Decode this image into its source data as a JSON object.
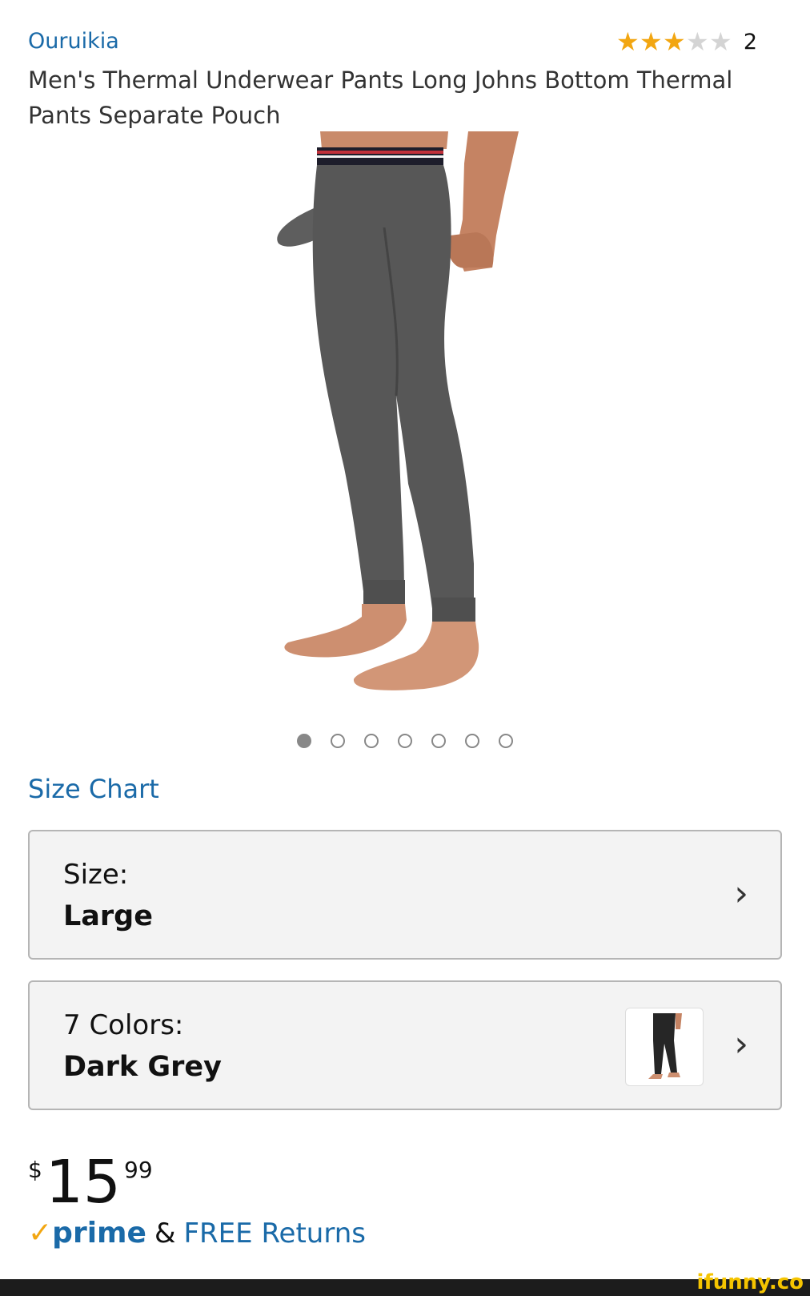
{
  "brand": "Ouruikia",
  "rating": {
    "stars_filled": 3,
    "stars_total": 5,
    "count": "2"
  },
  "title": "Men's Thermal Underwear Pants Long Johns Bottom Thermal Pants Separate Pouch",
  "carousel": {
    "total": 7,
    "active_index": 0
  },
  "size_chart_link": "Size Chart",
  "size_selector": {
    "label": "Size:",
    "value": "Large"
  },
  "color_selector": {
    "label": "7 Colors:",
    "value": "Dark Grey"
  },
  "price": {
    "currency": "$",
    "whole": "15",
    "fraction": "99"
  },
  "prime": {
    "check": "✓",
    "word": "prime",
    "amp": "&",
    "free_returns": "FREE Returns"
  },
  "watermark": "ifunny.co",
  "colors": {
    "link": "#1a6aa8",
    "star": "#f2a611",
    "prime_check": "#f2a611"
  }
}
